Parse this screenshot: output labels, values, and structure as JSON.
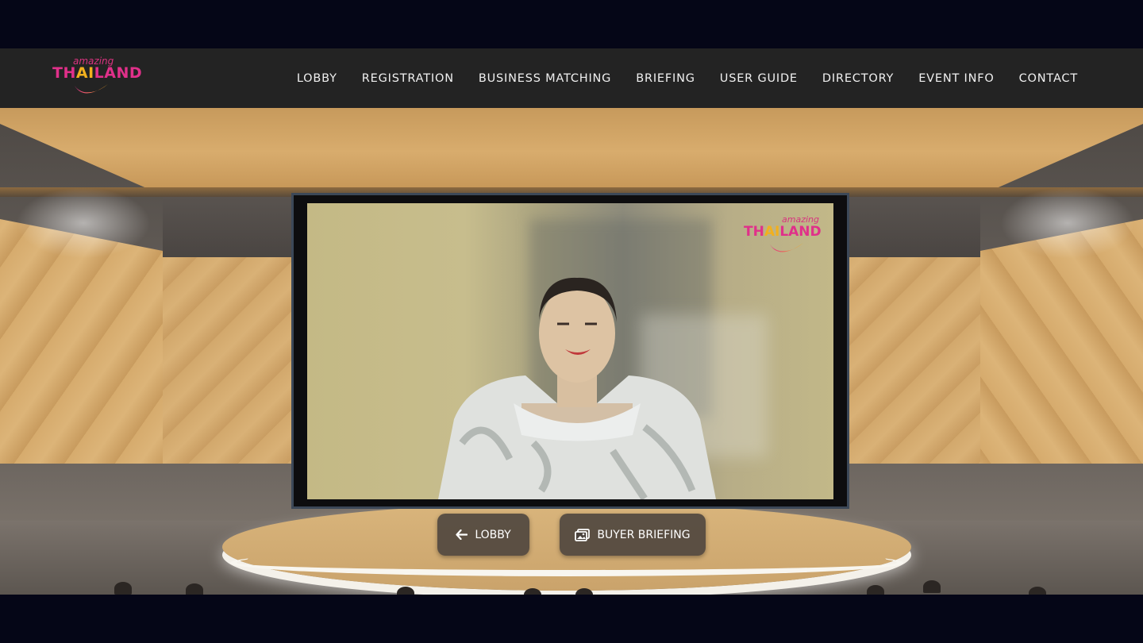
{
  "brand": {
    "logo_small": "amazing",
    "logo_big_left": "TH",
    "logo_big_mid": "AI",
    "logo_big_right": "LAND",
    "colors": {
      "pink": "#e0308a",
      "gold": "#f2b01e"
    }
  },
  "nav": {
    "items": [
      {
        "label": "LOBBY"
      },
      {
        "label": "REGISTRATION"
      },
      {
        "label": "BUSINESS MATCHING"
      },
      {
        "label": "BRIEFING"
      },
      {
        "label": "USER GUIDE"
      },
      {
        "label": "DIRECTORY"
      },
      {
        "label": "EVENT INFO"
      },
      {
        "label": "CONTACT"
      }
    ]
  },
  "video": {
    "watermark_small": "amazing",
    "watermark_big_left": "TH",
    "watermark_big_mid": "AI",
    "watermark_big_right": "LAND"
  },
  "actions": {
    "lobby": {
      "label": "LOBBY",
      "icon": "arrow-left-icon"
    },
    "briefing": {
      "label": "BUYER BRIEFING",
      "icon": "images-icon"
    }
  }
}
